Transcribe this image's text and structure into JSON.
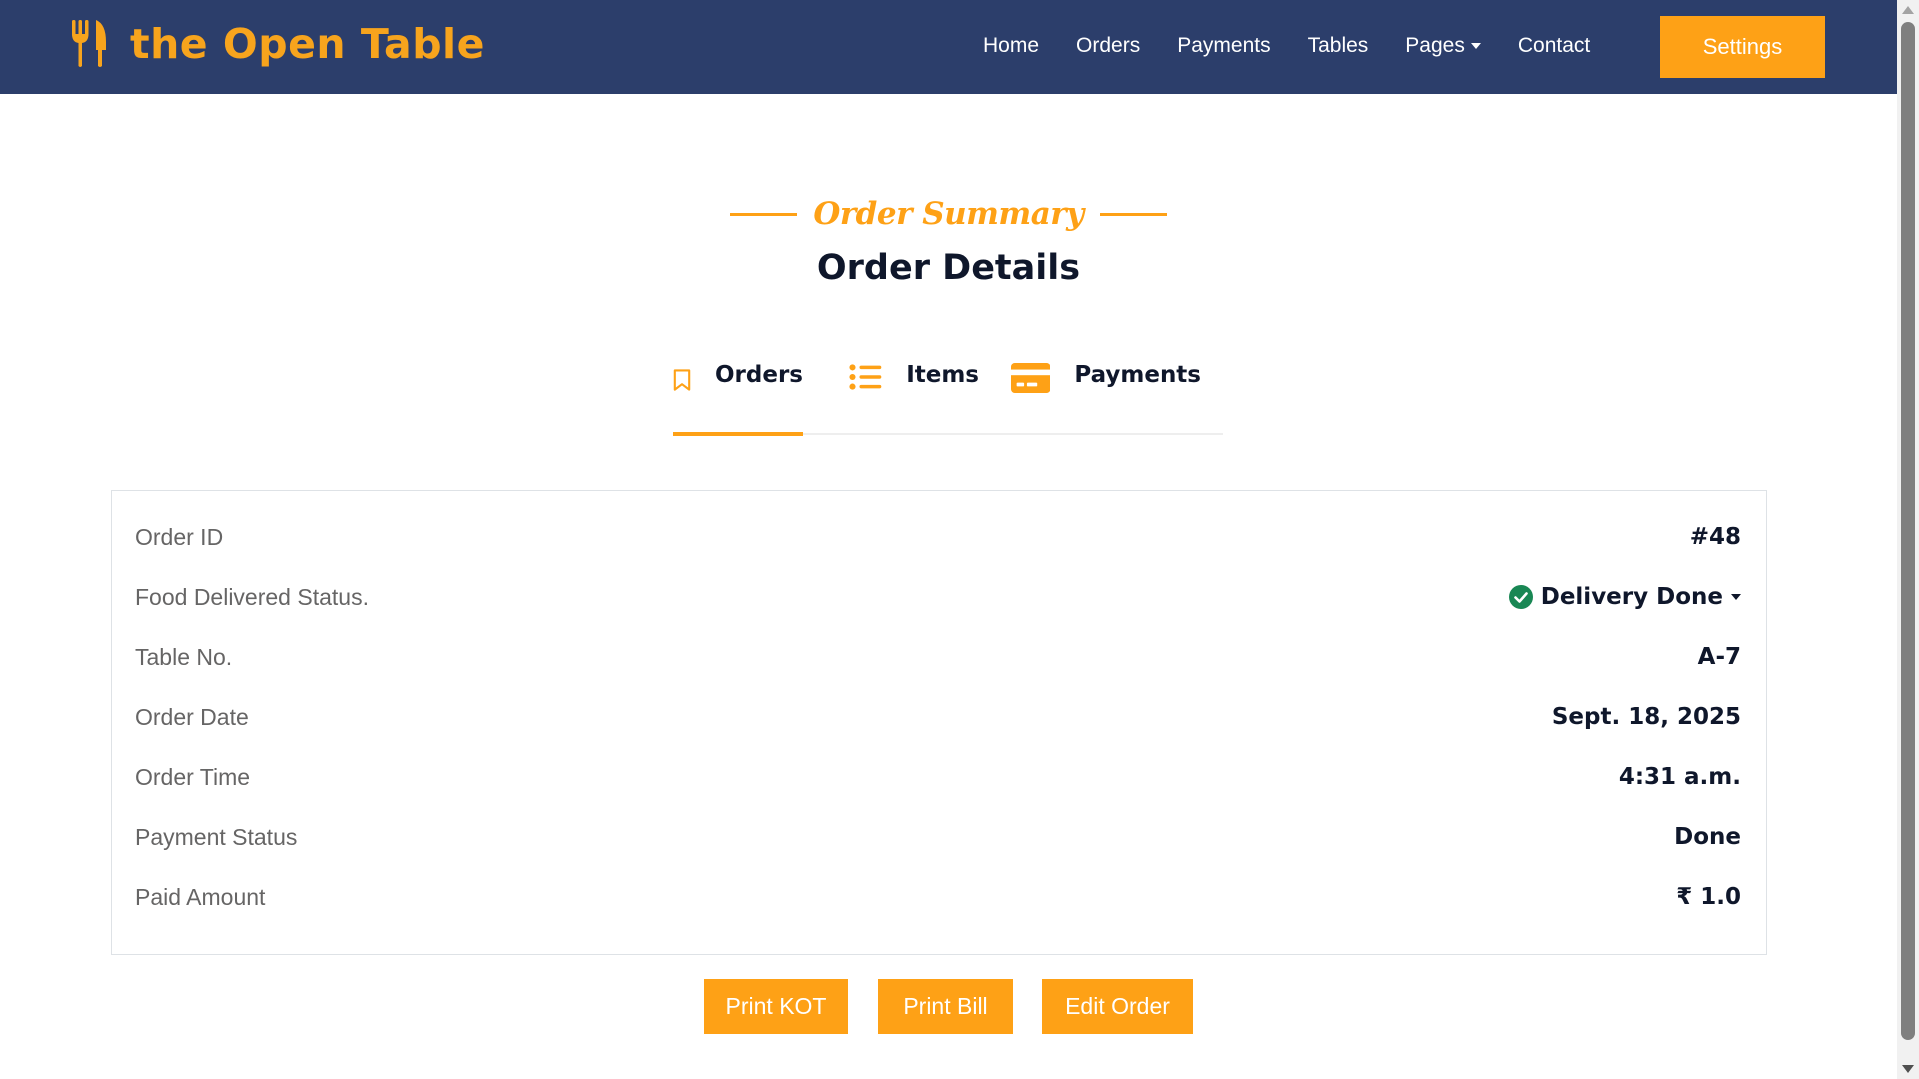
{
  "brand": {
    "name": "the Open Table",
    "icon": "utensils-icon",
    "color": "#f7a41d"
  },
  "nav": {
    "items": [
      {
        "label": "Home"
      },
      {
        "label": "Orders"
      },
      {
        "label": "Payments"
      },
      {
        "label": "Tables"
      },
      {
        "label": "Pages",
        "dropdown": true
      },
      {
        "label": "Contact"
      }
    ],
    "settings_label": "Settings",
    "background": "#2c3e6b"
  },
  "header": {
    "subtitle": "Order Summary",
    "title": "Order Details"
  },
  "tabs": [
    {
      "label": "Orders",
      "icon": "bookmark-icon",
      "active": true
    },
    {
      "label": "Items",
      "icon": "list-icon",
      "active": false
    },
    {
      "label": "Payments",
      "icon": "credit-card-icon",
      "active": false
    }
  ],
  "order": {
    "rows": [
      {
        "label": "Order ID",
        "value": "#48"
      },
      {
        "label": "Food Delivered Status.",
        "value": "Delivery Done"
      },
      {
        "label": "Table No.",
        "value": "A-7"
      },
      {
        "label": "Order Date",
        "value": "Sept. 18, 2025"
      },
      {
        "label": "Order Time",
        "value": "4:31 a.m."
      },
      {
        "label": "Payment Status",
        "value": "Done"
      },
      {
        "label": "Paid Amount",
        "value": "₹ 1.0"
      }
    ]
  },
  "actions": {
    "print_kot": "Print KOT",
    "print_bill": "Print Bill",
    "edit_order": "Edit Order"
  },
  "colors": {
    "accent": "#fea116",
    "success": "#198754",
    "heading": "#0f172b"
  }
}
